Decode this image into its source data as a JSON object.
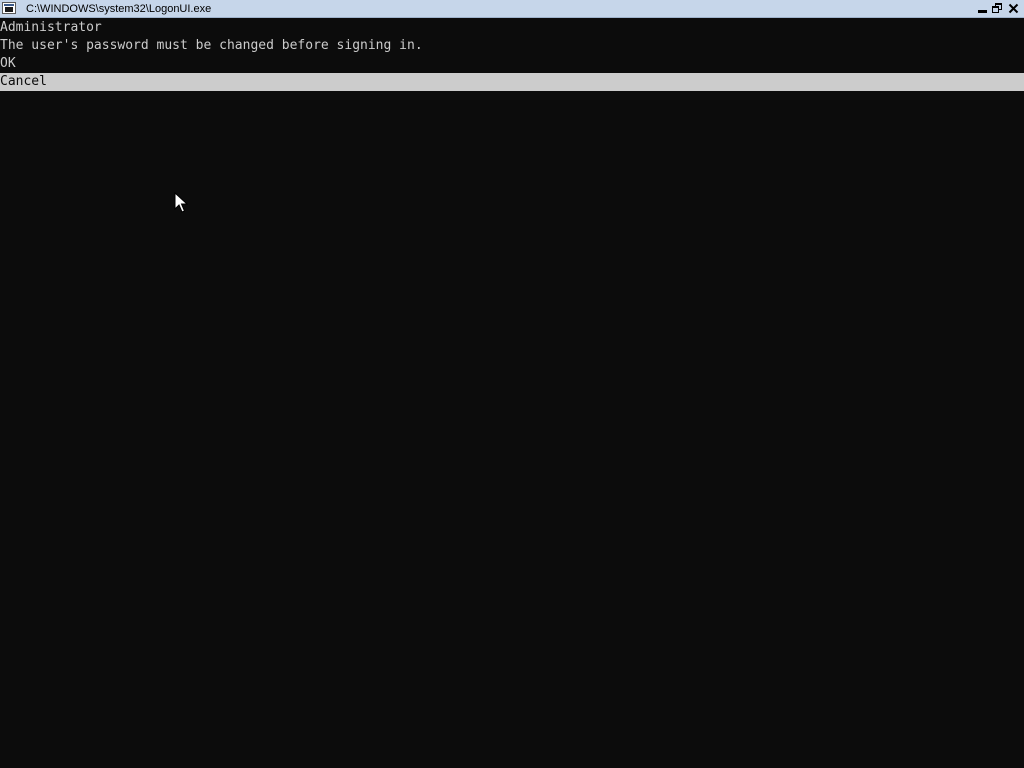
{
  "window": {
    "title": "C:\\WINDOWS\\system32\\LogonUI.exe",
    "icon": "console-app-icon",
    "controls": {
      "minimize": "minimize-icon",
      "restore": "restore-icon",
      "close": "close-icon"
    },
    "titlebar_color": "#c6d6ea"
  },
  "console": {
    "background": "#0c0c0c",
    "foreground": "#cccccc",
    "username": "Administrator",
    "message": "The user's password must be changed before signing in.",
    "options": [
      {
        "label": "OK",
        "selected": false
      },
      {
        "label": "Cancel",
        "selected": true
      }
    ],
    "selection_color": "#cccccc"
  },
  "pointer": "mouse-pointer-icon"
}
